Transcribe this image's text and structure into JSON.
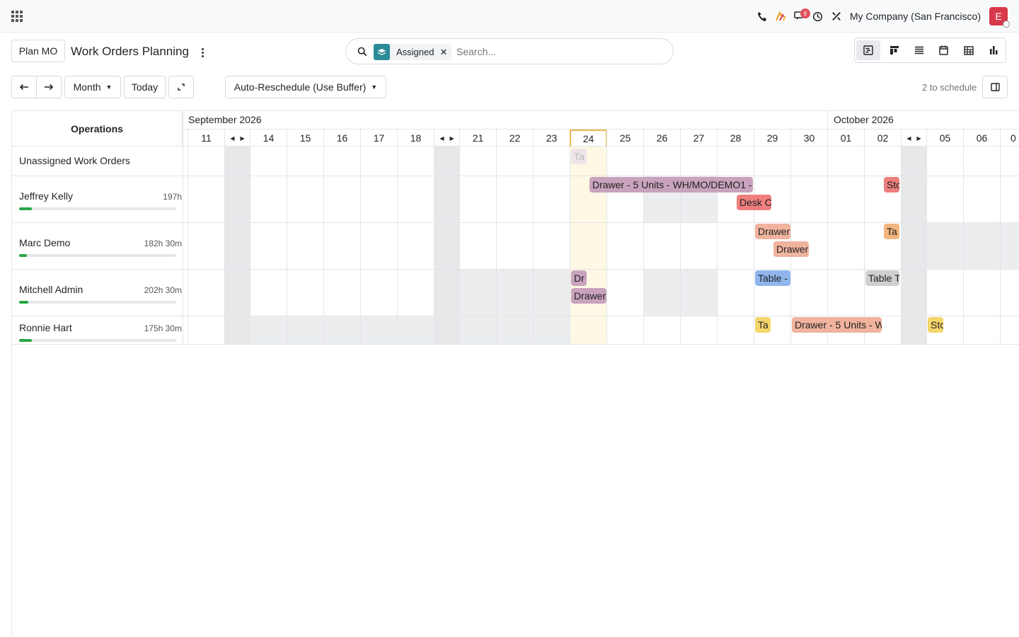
{
  "topbar": {
    "company": "My Company (San Francisco)",
    "avatar_letter": "E",
    "messages_badge": "9",
    "icons": [
      "phone-icon",
      "activity-chart-icon",
      "messages-icon",
      "clock-icon",
      "tools-icon"
    ]
  },
  "control": {
    "plan_mo": "Plan MO",
    "title": "Work Orders Planning",
    "search": {
      "facet": "Assigned",
      "placeholder": "Search..."
    },
    "month": "Month",
    "today": "Today",
    "reschedule": "Auto-Reschedule (Use Buffer)",
    "to_schedule": "2 to schedule",
    "views": [
      "gantt-view",
      "kanban-view",
      "list-view",
      "calendar-view",
      "pivot-view",
      "graph-view"
    ]
  },
  "gantt": {
    "header": "Operations",
    "months": [
      {
        "label": "September 2026"
      },
      {
        "label": "October 2026"
      }
    ],
    "days": [
      "11",
      "14",
      "15",
      "16",
      "17",
      "18",
      "21",
      "22",
      "23",
      "24",
      "25",
      "26",
      "27",
      "28",
      "29",
      "30",
      "01",
      "02",
      "05",
      "06",
      "0"
    ],
    "today": "24",
    "rows": [
      {
        "name": "Unassigned Work Orders",
        "hours": "",
        "progress": 0
      },
      {
        "name": "Jeffrey Kelly",
        "hours": "197h",
        "progress": 0.08
      },
      {
        "name": "Marc Demo",
        "hours": "182h 30m",
        "progress": 0.05
      },
      {
        "name": "Mitchell Admin",
        "hours": "202h 30m",
        "progress": 0.06
      },
      {
        "name": "Ronnie Hart",
        "hours": "175h 30m",
        "progress": 0.08
      }
    ],
    "pills": [
      {
        "text": "Ta",
        "color": "#eee5ea"
      },
      {
        "text": "Drawer - 5 Units - WH/MO/DEMO1 -",
        "color": "#c9a3bd"
      },
      {
        "text": "Desk C",
        "color": "#ef7e7e"
      },
      {
        "text": "Stc",
        "color": "#ef7e7e"
      },
      {
        "text": "Drawer",
        "color": "#f0b39d"
      },
      {
        "text": "Drawer",
        "color": "#f0b39d"
      },
      {
        "text": "Ta",
        "color": "#f4b57e"
      },
      {
        "text": "Dr",
        "color": "#c9a3bd"
      },
      {
        "text": "Drawer",
        "color": "#c9a3bd"
      },
      {
        "text": "Table -",
        "color": "#8fb5ec"
      },
      {
        "text": "Table T",
        "color": "#cfcfcf"
      },
      {
        "text": "Ta",
        "color": "#f5d66b"
      },
      {
        "text": "Drawer - 5 Units - W",
        "color": "#f0b39d"
      },
      {
        "text": "Stc",
        "color": "#f5d66b"
      }
    ]
  }
}
